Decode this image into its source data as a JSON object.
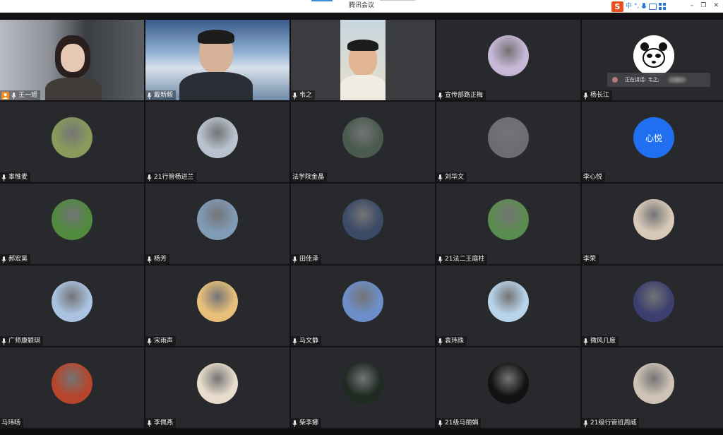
{
  "window": {
    "title": "腾讯会议",
    "controls": [
      "–",
      "❐",
      "✕"
    ]
  },
  "ime_toolbar": {
    "logo": "S",
    "mode": "中",
    "punct": "°,",
    "icons": [
      "mic-icon",
      "keyboard-icon",
      "grid-icon"
    ]
  },
  "speaking_indicator": {
    "label": "正在讲话: 韦之;"
  },
  "participants": [
    {
      "name": "王一瑶",
      "host": true,
      "type": "video"
    },
    {
      "name": "戴新毅",
      "type": "video"
    },
    {
      "name": "韦之",
      "type": "video",
      "active_speaker": true
    },
    {
      "name": "宣传部路正梅",
      "type": "avatar",
      "color": "#c7b8d8"
    },
    {
      "name": "杨长江",
      "type": "avatar",
      "color": "#ffffff"
    },
    {
      "name": "辜惟麦",
      "type": "avatar",
      "color": "#8a9a5b"
    },
    {
      "name": "21行管杨进兰",
      "type": "avatar",
      "color": "#b9c3cf"
    },
    {
      "name": "法学院金晶",
      "type": "avatar",
      "color": "#4a5a4e",
      "no_mic": true
    },
    {
      "name": "刘华文",
      "type": "avatar",
      "color": "#6b6d73"
    },
    {
      "name": "李心悦",
      "type": "initials",
      "initials": "心悦",
      "color": "#1f6ff0",
      "no_mic": true
    },
    {
      "name": "郝宏昊",
      "type": "avatar",
      "color": "#4f8a3e"
    },
    {
      "name": "杨芳",
      "type": "avatar",
      "color": "#7f9bb5"
    },
    {
      "name": "田佳泽",
      "type": "avatar",
      "color": "#3b4a66"
    },
    {
      "name": "21法二王庭柱",
      "type": "avatar",
      "color": "#5b8c4f"
    },
    {
      "name": "李荣",
      "type": "avatar",
      "color": "#d9c9b8",
      "no_mic": true
    },
    {
      "name": "广师康颖琪",
      "type": "avatar",
      "color": "#a9c3e0"
    },
    {
      "name": "宋雨声",
      "type": "avatar",
      "color": "#e8c07a"
    },
    {
      "name": "马文静",
      "type": "avatar",
      "color": "#6d8fc9"
    },
    {
      "name": "袁玮珠",
      "type": "avatar",
      "color": "#b8d4ea"
    },
    {
      "name": "微风几度",
      "type": "avatar",
      "color": "#3c3f6e"
    },
    {
      "name": "马玮旸",
      "type": "avatar",
      "color": "#b5462c",
      "no_mic": true
    },
    {
      "name": "李佩燕",
      "type": "avatar",
      "color": "#e9dccc"
    },
    {
      "name": "柴李娜",
      "type": "avatar",
      "color": "#1f2a22"
    },
    {
      "name": "21级马丽娟",
      "type": "avatar",
      "color": "#121212"
    },
    {
      "name": "21级行管班周威",
      "type": "avatar",
      "color": "#cfc3b5"
    }
  ]
}
